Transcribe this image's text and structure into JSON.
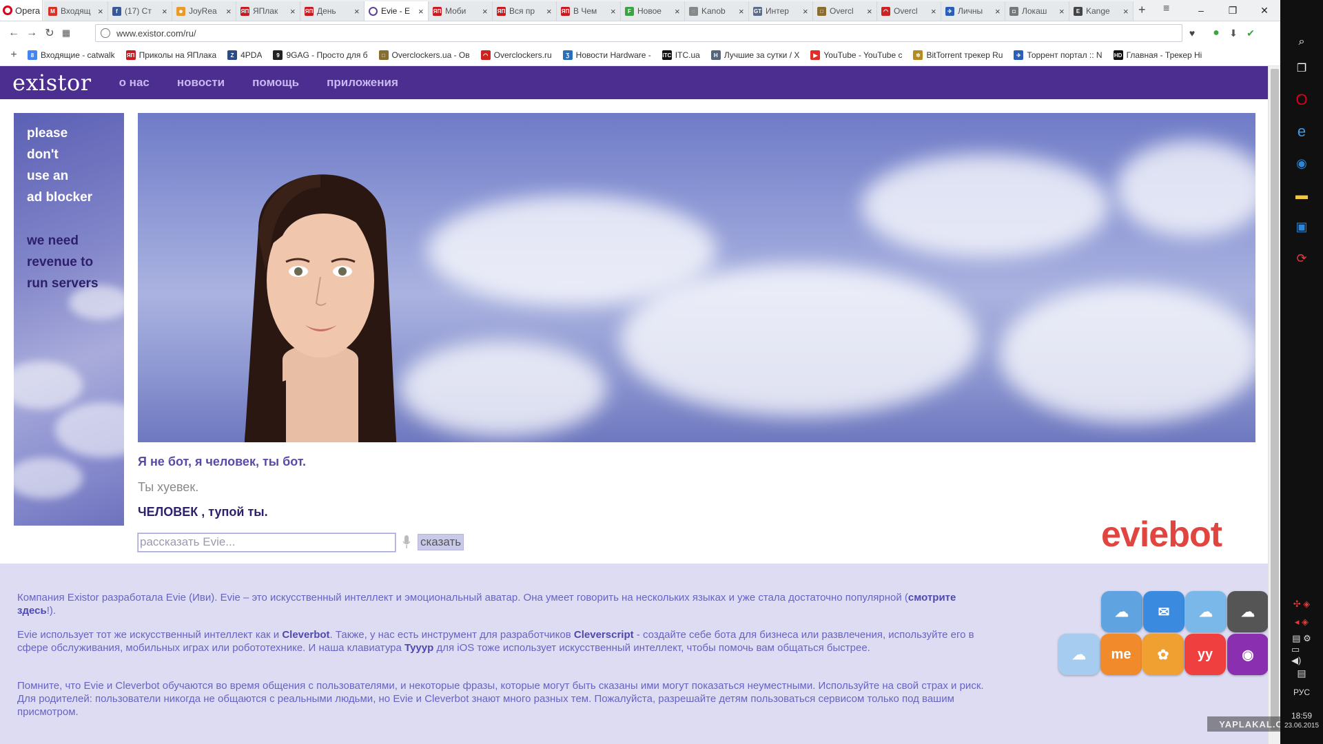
{
  "browser": {
    "menu_label": "Opera",
    "tabs": [
      {
        "label": "Входящ",
        "icon": "gmail-icon",
        "color": "#d93025",
        "glyph": "M",
        "active": false
      },
      {
        "label": "(17) Ст",
        "icon": "facebook-icon",
        "color": "#3b5998",
        "glyph": "f",
        "active": false
      },
      {
        "label": "JoyRea",
        "icon": "joyreactor-icon",
        "color": "#e89b2a",
        "glyph": "☻",
        "active": false
      },
      {
        "label": "ЯПлак",
        "icon": "yaplakal-icon",
        "color": "#c9191e",
        "glyph": "ЯП",
        "active": false
      },
      {
        "label": "День",
        "icon": "yaplakal-icon",
        "color": "#c9191e",
        "glyph": "ЯП",
        "active": false
      },
      {
        "label": "Evie - E",
        "icon": "evie-icon",
        "color": "#ffffff",
        "glyph": "",
        "active": true
      },
      {
        "label": "Моби",
        "icon": "yaplakal-icon",
        "color": "#c9191e",
        "glyph": "ЯП",
        "active": false
      },
      {
        "label": "Вся пр",
        "icon": "yaplakal-icon",
        "color": "#c9191e",
        "glyph": "ЯП",
        "active": false
      },
      {
        "label": "В Чем",
        "icon": "yaplakal-icon",
        "color": "#c9191e",
        "glyph": "ЯП",
        "active": false
      },
      {
        "label": "Новое",
        "icon": "green-f-icon",
        "color": "#3aa342",
        "glyph": "F",
        "active": false
      },
      {
        "label": "Kanob",
        "icon": "loading-icon",
        "color": "#888888",
        "glyph": "◌",
        "active": false
      },
      {
        "label": "Интер",
        "icon": "gt-icon",
        "color": "#5a6b8c",
        "glyph": "GT",
        "active": false
      },
      {
        "label": "Overcl",
        "icon": "overclockers-ua-icon",
        "color": "#8a6d2c",
        "glyph": "□",
        "active": false
      },
      {
        "label": "Overcl",
        "icon": "overclockers-ru-icon",
        "color": "#cc2222",
        "glyph": "◠",
        "active": false
      },
      {
        "label": "Личны",
        "icon": "bird-icon",
        "color": "#2a5fb8",
        "glyph": "✈",
        "active": false
      },
      {
        "label": "Локаш",
        "icon": "lock-icon",
        "color": "#777777",
        "glyph": "◘",
        "active": false
      },
      {
        "label": "Kange",
        "icon": "e-icon",
        "color": "#444444",
        "glyph": "E",
        "active": false
      }
    ],
    "url": "www.existor.com/ru/",
    "bookmarks": [
      {
        "label": "Входящие - catwalk",
        "icon": "google-icon",
        "color": "#4285f4",
        "glyph": "8"
      },
      {
        "label": "Приколы на ЯПлака",
        "icon": "yaplakal-icon",
        "color": "#c9191e",
        "glyph": "ЯП"
      },
      {
        "label": "4PDA",
        "icon": "4pda-icon",
        "color": "#2c4a86",
        "glyph": "Z"
      },
      {
        "label": "9GAG - Просто для б",
        "icon": "9gag-icon",
        "color": "#222222",
        "glyph": "9"
      },
      {
        "label": "Overclockers.ua - Ов",
        "icon": "overclockers-ua-icon",
        "color": "#8a6d2c",
        "glyph": "□"
      },
      {
        "label": "Overclockers.ru",
        "icon": "overclockers-ru-icon",
        "color": "#cc2222",
        "glyph": "◠"
      },
      {
        "label": "Новости Hardware -",
        "icon": "hardware-icon",
        "color": "#2b6fb6",
        "glyph": "Ʒ"
      },
      {
        "label": "ITC.ua",
        "icon": "itc-icon",
        "color": "#111111",
        "glyph": "iTC"
      },
      {
        "label": "Лучшие за сутки / Х",
        "icon": "habr-icon",
        "color": "#55677d",
        "glyph": "H"
      },
      {
        "label": "YouTube - YouTube c",
        "icon": "youtube-icon",
        "color": "#e52d27",
        "glyph": "▶"
      },
      {
        "label": "BitTorrent трекер Ru",
        "icon": "rutracker-icon",
        "color": "#b58a1f",
        "glyph": "✲"
      },
      {
        "label": "Торрент портал :: N",
        "icon": "nnm-icon",
        "color": "#2a5fb8",
        "glyph": "✈"
      },
      {
        "label": "Главная - Трекер Hi",
        "icon": "hd-icon",
        "color": "#111111",
        "glyph": "HD"
      }
    ]
  },
  "site": {
    "logo": "existor",
    "nav": [
      "о нас",
      "новости",
      "помощь",
      "приложения"
    ],
    "ad_lines_1": [
      "please",
      "don't",
      "use an",
      "ad blocker"
    ],
    "ad_lines_2": [
      "we need",
      "revenue to",
      "run servers"
    ],
    "chat": {
      "evie_line": "Я не бот, я человек, ты бот.",
      "user_line": "Ты хуевек.",
      "evie_reply": "ЧЕЛОВЕК , тупой ты."
    },
    "input_placeholder": "рассказать Evie...",
    "say_button": "сказать",
    "brand": "eviebot",
    "footer": {
      "p1_a": "Компания Existor разработала Evie (Иви). Evie – это искусственный интеллект и эмоциональный аватар. Она умеет говорить на нескольких языках и уже стала достаточно популярной (",
      "p1_link": "смотрите здесь",
      "p1_b": "!).",
      "p2_a": "Evie использует тот же искусственный интеллект как и ",
      "p2_link1": "Cleverbot",
      "p2_b": ". Также, у нас есть инструмент для разработчиков ",
      "p2_link2": "Cleverscript",
      "p2_c": " - создайте себе бота для бизнеса или развлечения, используйте его в сфере обслуживания, мобильных играх или робототехнике. И наша клавиатура ",
      "p2_link3": "Tyyyp",
      "p2_d": " для iOS тоже использует искусственный интеллект, чтобы помочь вам общаться быстрее.",
      "p3": "Помните, что Evie и Cleverbot обучаются во время общения с пользователями, и некоторые фразы, которые могут быть сказаны ими могут показаться неуместными. Используйте на свой страх и риск. Для родителей: пользователи никогда не общаются с реальными людьми, но Evie и Cleverbot знают много разных тем. Пожалуйста, разрешайте детям пользоваться сервисом только под вашим присмотром."
    },
    "apps": [
      {
        "name": "cleverbot-app-icon",
        "color": "#5fa4e0",
        "glyph": "☁"
      },
      {
        "name": "cleverbot-chat-app-icon",
        "color": "#3a8be0",
        "glyph": "✉"
      },
      {
        "name": "cleverbot-bubble-app-icon",
        "color": "#7ab8ea",
        "glyph": "☁"
      },
      {
        "name": "cleverbot-dark-app-icon",
        "color": "#555555",
        "glyph": "☁"
      },
      {
        "name": "cleverbot-light-app-icon",
        "color": "#a6cdef",
        "glyph": "☁"
      },
      {
        "name": "me-app-icon",
        "color": "#f08a2a",
        "glyph": "me"
      },
      {
        "name": "flower-app-icon",
        "color": "#f0a030",
        "glyph": "✿"
      },
      {
        "name": "tyyyp-app-icon",
        "color": "#ef3f3f",
        "glyph": "yy"
      },
      {
        "name": "frog-app-icon",
        "color": "#8a2fb0",
        "glyph": "◉"
      }
    ]
  },
  "watermark": "YAPLAKAL.COM",
  "taskbar": {
    "lang": "РУС",
    "time": "18:59",
    "date": "23.06.2015"
  }
}
